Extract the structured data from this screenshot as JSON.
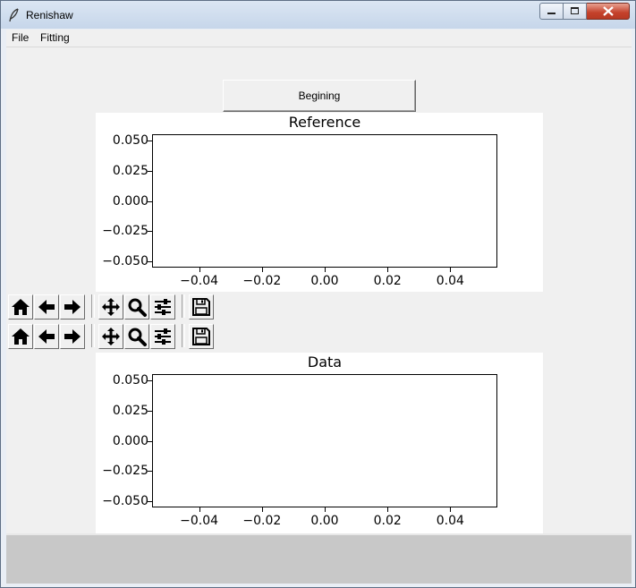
{
  "window": {
    "title": "Renishaw"
  },
  "menu": {
    "items": [
      "File",
      "Fitting"
    ]
  },
  "main": {
    "begin_button": "Begining"
  },
  "icons": {
    "home": "home-icon",
    "back": "arrow-left-icon",
    "forward": "arrow-right-icon",
    "pan": "pan-move-icon",
    "zoom": "magnifier-zoom-icon",
    "configure": "sliders-configure-icon",
    "save": "floppy-save-icon"
  },
  "chart_data": [
    {
      "type": "line",
      "title": "Reference",
      "series": [],
      "xlim": [
        -0.055,
        0.055
      ],
      "ylim": [
        -0.055,
        0.055
      ],
      "xticks": [
        "−0.04",
        "−0.02",
        "0.00",
        "0.02",
        "0.04"
      ],
      "yticks": [
        "0.050",
        "0.025",
        "0.000",
        "−0.025",
        "−0.050"
      ]
    },
    {
      "type": "line",
      "title": "Data",
      "series": [],
      "xlim": [
        -0.055,
        0.055
      ],
      "ylim": [
        -0.055,
        0.055
      ],
      "xticks": [
        "−0.04",
        "−0.02",
        "0.00",
        "0.02",
        "0.04"
      ],
      "yticks": [
        "0.050",
        "0.025",
        "0.000",
        "−0.025",
        "−0.050"
      ]
    }
  ]
}
